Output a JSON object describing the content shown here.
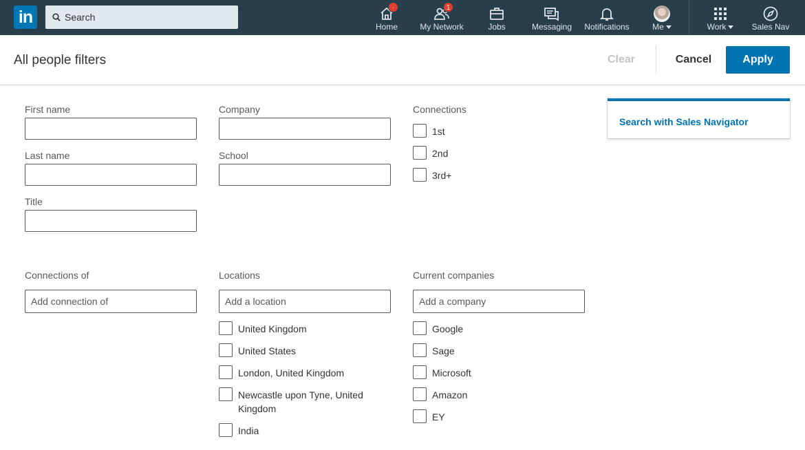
{
  "nav": {
    "logo_text": "in",
    "search_placeholder": "Search",
    "items": [
      {
        "label": "Home",
        "icon": "home-icon",
        "badge": "·"
      },
      {
        "label": "My Network",
        "icon": "people-icon",
        "badge": "1"
      },
      {
        "label": "Jobs",
        "icon": "briefcase-icon"
      },
      {
        "label": "Messaging",
        "icon": "messaging-icon"
      },
      {
        "label": "Notifications",
        "icon": "bell-icon"
      },
      {
        "label": "Me",
        "icon": "avatar"
      },
      {
        "label": "Work",
        "icon": "grid-icon"
      },
      {
        "label": "Sales Nav",
        "icon": "compass-icon"
      }
    ]
  },
  "header": {
    "title": "All people filters",
    "clear_label": "Clear",
    "cancel_label": "Cancel",
    "apply_label": "Apply"
  },
  "filters": {
    "first_name": {
      "label": "First name",
      "value": ""
    },
    "last_name": {
      "label": "Last name",
      "value": ""
    },
    "title": {
      "label": "Title",
      "value": ""
    },
    "company": {
      "label": "Company",
      "value": ""
    },
    "school": {
      "label": "School",
      "value": ""
    },
    "connections": {
      "label": "Connections",
      "options": [
        "1st",
        "2nd",
        "3rd+"
      ]
    },
    "connections_of": {
      "label": "Connections of",
      "placeholder": "Add connection of"
    },
    "locations": {
      "label": "Locations",
      "placeholder": "Add a location",
      "options": [
        "United Kingdom",
        "United States",
        "London, United Kingdom",
        "Newcastle upon Tyne, United Kingdom",
        "India"
      ]
    },
    "current_companies": {
      "label": "Current companies",
      "placeholder": "Add a company",
      "options": [
        "Google",
        "Sage",
        "Microsoft",
        "Amazon",
        "EY"
      ]
    }
  },
  "sales_nav_card": {
    "link_text": "Search with Sales Navigator"
  },
  "colors": {
    "nav_bg": "#283e4a",
    "brand": "#0073b1",
    "badge": "#e03e2f"
  }
}
